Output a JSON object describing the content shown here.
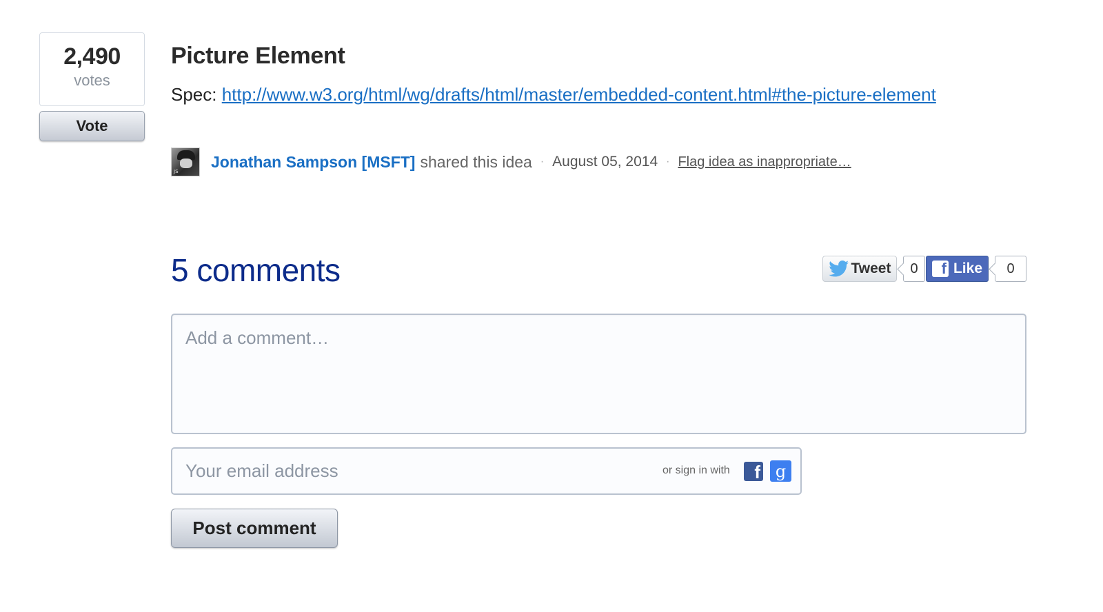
{
  "vote": {
    "count": "2,490",
    "unit": "votes",
    "button_label": "Vote"
  },
  "idea": {
    "title": "Picture Element",
    "spec_prefix": "Spec: ",
    "spec_url": "http://www.w3.org/html/wg/drafts/html/master/embedded-content.html#the-picture-element",
    "author": "Jonathan Sampson [MSFT]",
    "author_avatar_initials": "JS",
    "shared_text": "shared this idea",
    "separator": "·",
    "date": "August 05, 2014",
    "flag_label": "Flag idea as inappropriate…"
  },
  "comments": {
    "heading": "5 comments",
    "comment_placeholder": "Add a comment…",
    "email_placeholder": "Your email address",
    "signin_text": "or sign in with",
    "facebook_icon": "facebook-icon",
    "google_icon": "google-icon",
    "post_label": "Post comment"
  },
  "social": {
    "tweet_label": "Tweet",
    "tweet_count": "0",
    "like_label": "Like",
    "like_count": "0"
  },
  "colors": {
    "link": "#1a6fc4",
    "heading": "#0c2b8a",
    "facebook": "#4c69ba",
    "google": "#3d7ff0",
    "twitter": "#55acee"
  }
}
